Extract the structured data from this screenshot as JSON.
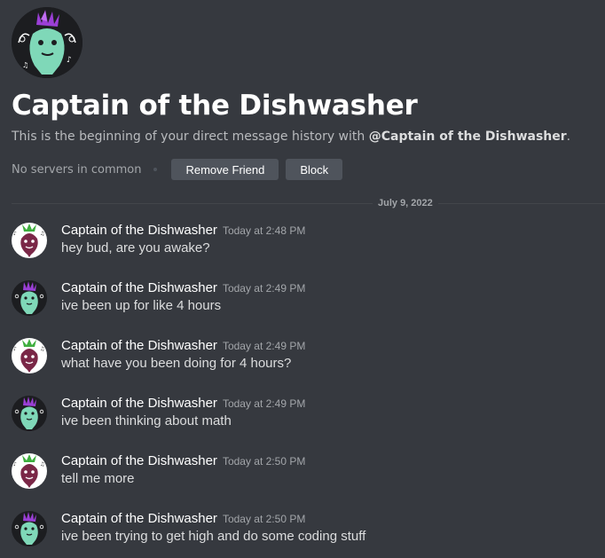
{
  "profile": {
    "avatar_icon": "green-creature-purple-hair-icon",
    "title": "Captain of the Dishwasher",
    "intro_prefix": "This is the beginning of your direct message history with ",
    "intro_handle": "@Captain of the Dishwasher",
    "intro_suffix": ".",
    "mutual_servers": "No servers in common",
    "remove_friend_label": "Remove Friend",
    "block_label": "Block"
  },
  "divider_date": "July 9, 2022",
  "messages": [
    {
      "author": "Captain of the Dishwasher",
      "time": "Today at 2:48 PM",
      "text": "hey bud, are you awake?",
      "avatar": "beet-avatar-icon"
    },
    {
      "author": "Captain of the Dishwasher",
      "time": "Today at 2:49 PM",
      "text": "ive been up for like 4 hours",
      "avatar": "green-creature-avatar-icon"
    },
    {
      "author": "Captain of the Dishwasher",
      "time": "Today at 2:49 PM",
      "text": "what have you been doing for 4 hours?",
      "avatar": "beet-avatar-icon"
    },
    {
      "author": "Captain of the Dishwasher",
      "time": "Today at 2:49 PM",
      "text": "ive been thinking about math",
      "avatar": "green-creature-avatar-icon"
    },
    {
      "author": "Captain of the Dishwasher",
      "time": "Today at 2:50 PM",
      "text": "tell me more",
      "avatar": "beet-avatar-icon"
    },
    {
      "author": "Captain of the Dishwasher",
      "time": "Today at 2:50 PM",
      "text": "ive been trying to get high and do some coding stuff",
      "avatar": "green-creature-avatar-icon"
    }
  ],
  "colors": {
    "background": "#36393f",
    "button": "#4f545c",
    "creature_green": "#7fd8b8",
    "beet_red": "#7a2747",
    "hair_purple": "#9b3fd6"
  }
}
